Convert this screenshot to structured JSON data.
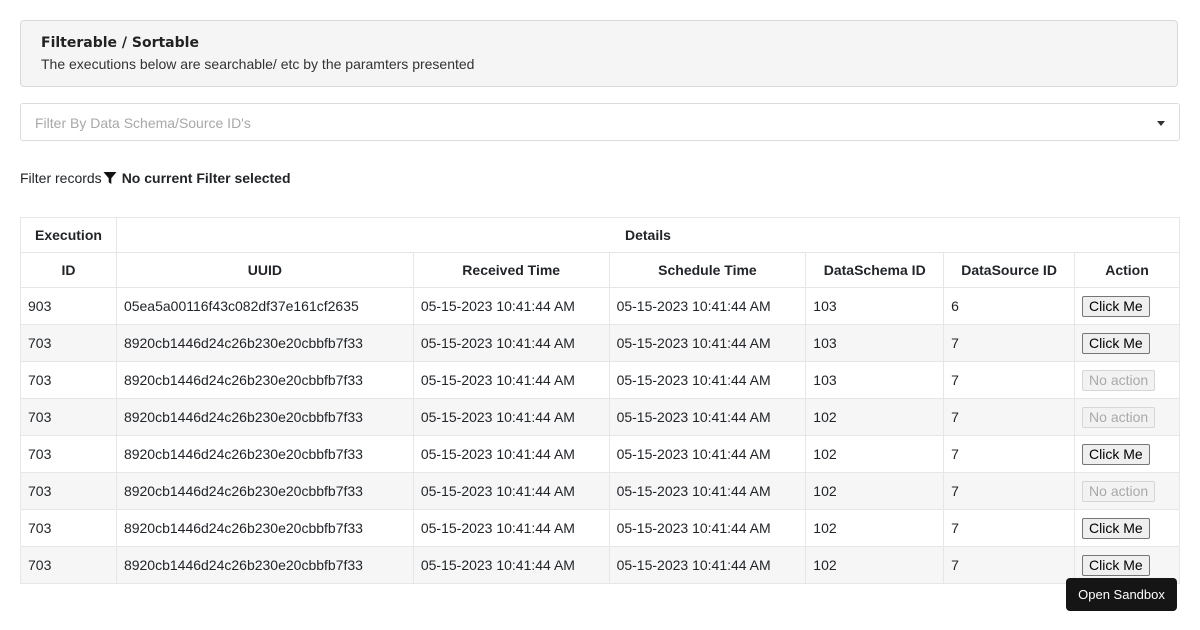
{
  "info": {
    "title": "Filterable / Sortable",
    "subtitle": "The executions below are searchable/ etc by the paramters presented"
  },
  "filter": {
    "placeholder": "Filter By Data Schema/Source ID's",
    "records_label": "Filter records",
    "status": "No current Filter selected",
    "icon": "funnel-icon"
  },
  "table": {
    "group_headers": [
      "Execution",
      "Details"
    ],
    "columns": [
      "ID",
      "UUID",
      "Received Time",
      "Schedule Time",
      "DataSchema ID",
      "DataSource ID",
      "Action"
    ],
    "rows": [
      {
        "id": "903",
        "uuid": "05ea5a00116f43c082df37e161cf2635",
        "received": "05-15-2023 10:41:44 AM",
        "schedule": "05-15-2023 10:41:44 AM",
        "schema": "103",
        "source": "6",
        "action": "Click Me",
        "enabled": true
      },
      {
        "id": "703",
        "uuid": "8920cb1446d24c26b230e20cbbfb7f33",
        "received": "05-15-2023 10:41:44 AM",
        "schedule": "05-15-2023 10:41:44 AM",
        "schema": "103",
        "source": "7",
        "action": "Click Me",
        "enabled": true
      },
      {
        "id": "703",
        "uuid": "8920cb1446d24c26b230e20cbbfb7f33",
        "received": "05-15-2023 10:41:44 AM",
        "schedule": "05-15-2023 10:41:44 AM",
        "schema": "103",
        "source": "7",
        "action": "No action",
        "enabled": false
      },
      {
        "id": "703",
        "uuid": "8920cb1446d24c26b230e20cbbfb7f33",
        "received": "05-15-2023 10:41:44 AM",
        "schedule": "05-15-2023 10:41:44 AM",
        "schema": "102",
        "source": "7",
        "action": "No action",
        "enabled": false
      },
      {
        "id": "703",
        "uuid": "8920cb1446d24c26b230e20cbbfb7f33",
        "received": "05-15-2023 10:41:44 AM",
        "schedule": "05-15-2023 10:41:44 AM",
        "schema": "102",
        "source": "7",
        "action": "Click Me",
        "enabled": true
      },
      {
        "id": "703",
        "uuid": "8920cb1446d24c26b230e20cbbfb7f33",
        "received": "05-15-2023 10:41:44 AM",
        "schedule": "05-15-2023 10:41:44 AM",
        "schema": "102",
        "source": "7",
        "action": "No action",
        "enabled": false
      },
      {
        "id": "703",
        "uuid": "8920cb1446d24c26b230e20cbbfb7f33",
        "received": "05-15-2023 10:41:44 AM",
        "schedule": "05-15-2023 10:41:44 AM",
        "schema": "102",
        "source": "7",
        "action": "Click Me",
        "enabled": true
      },
      {
        "id": "703",
        "uuid": "8920cb1446d24c26b230e20cbbfb7f33",
        "received": "05-15-2023 10:41:44 AM",
        "schedule": "05-15-2023 10:41:44 AM",
        "schema": "102",
        "source": "7",
        "action": "Click Me",
        "enabled": true
      }
    ]
  },
  "sandbox": {
    "label": "Open Sandbox"
  }
}
